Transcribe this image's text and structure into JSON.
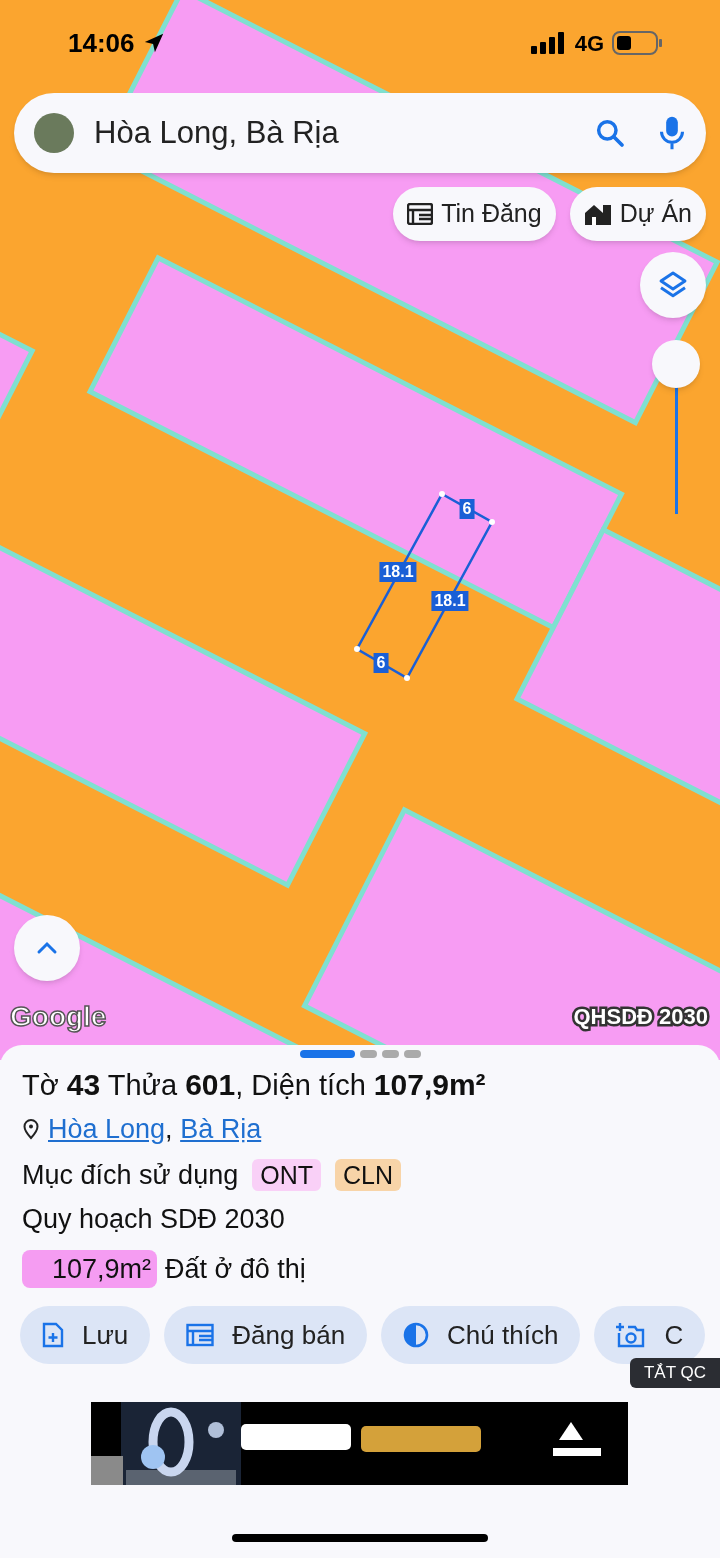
{
  "status_bar": {
    "time": "14:06",
    "network": "4G"
  },
  "search": {
    "value": "Hòa Long, Bà Rịa"
  },
  "map_chips": [
    {
      "label": "Tin Đăng",
      "kind": "listing"
    },
    {
      "label": "Dự Án",
      "kind": "project"
    }
  ],
  "map": {
    "kind": "picture",
    "zoom_slider": {
      "level": 1
    },
    "measurements": [
      {
        "text": "6"
      },
      {
        "text": "18.1"
      },
      {
        "text": "18.1"
      },
      {
        "text": "6"
      }
    ],
    "attribution": "Google",
    "layer_label": "QHSDĐ 2030"
  },
  "sheet": {
    "pages": [
      {
        "selected": true
      },
      {
        "selected": false
      },
      {
        "selected": false
      },
      {
        "selected": false
      }
    ],
    "title": "Tờ **43** Thửa **601**, Diện tích **107,9m²**",
    "location_links": [
      "Hòa Long",
      "Bà Rịa"
    ],
    "location_separator": ",",
    "usage_label": "Mục đích sử dụng",
    "usage_tags": [
      {
        "text": "ONT",
        "color": "#f9d0f7"
      },
      {
        "text": "CLN",
        "color": "#f8d4a8"
      }
    ],
    "planning": "Quy hoạch SDĐ 2030",
    "zones": [
      {
        "area": "107,9m²",
        "color": "#f59cf2",
        "description": "Đất ở đô thị"
      }
    ],
    "actions": [
      {
        "label": "Lưu"
      },
      {
        "label": "Đăng bán"
      },
      {
        "label": "Chú thích"
      },
      {
        "label": "C"
      }
    ],
    "ad_close": "TẮT QC"
  }
}
